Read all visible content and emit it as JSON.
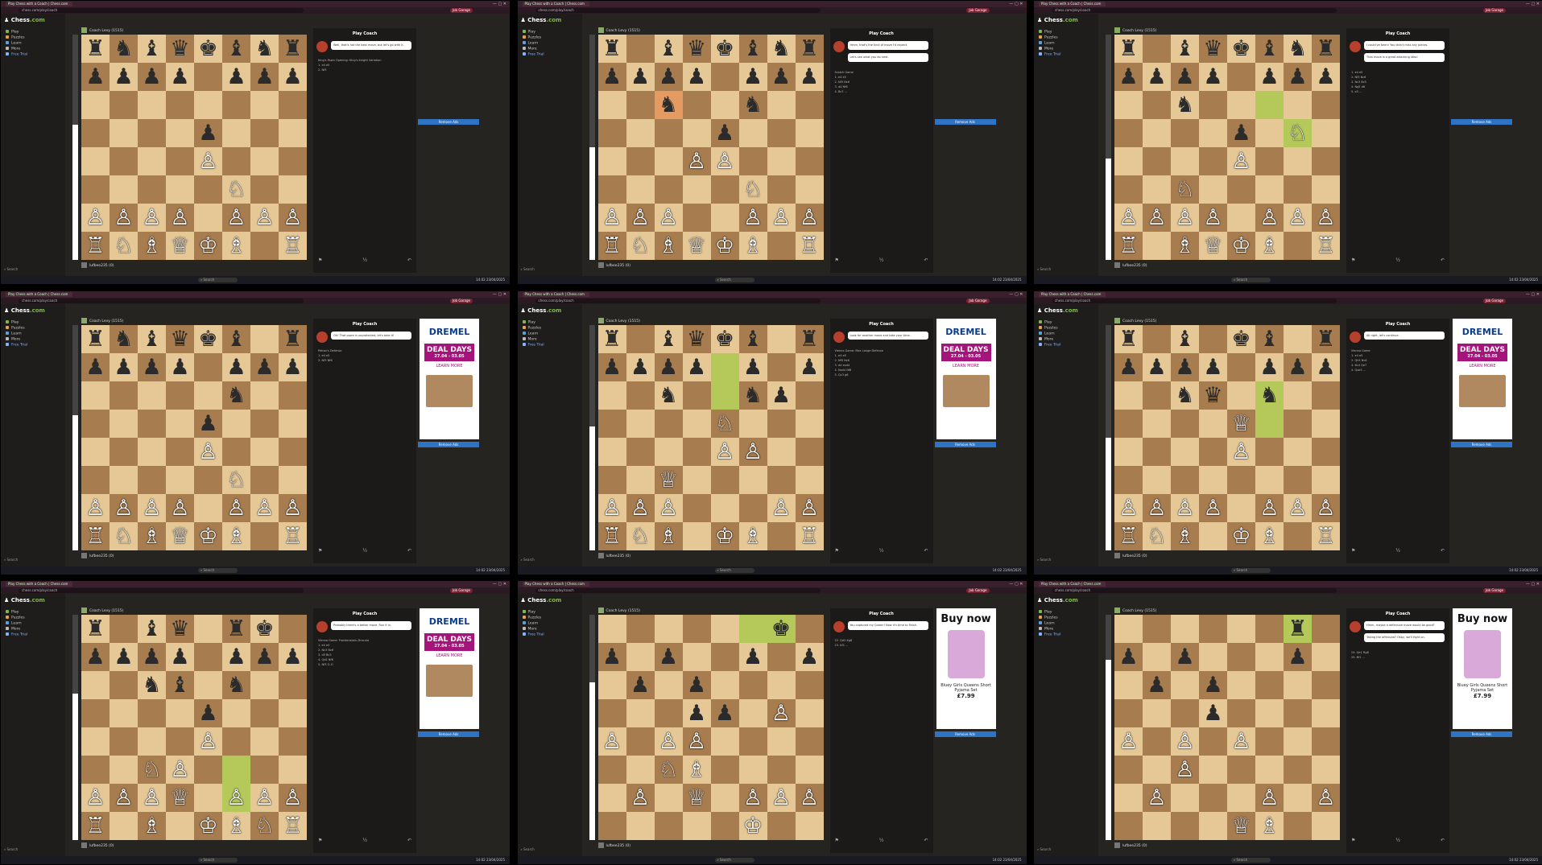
{
  "common": {
    "tab_title": "Play Chess with a Coach | Chess.com",
    "url": "chess.com/play/coach",
    "pill": "Job Garage",
    "logo_main": "Chess",
    "logo_suffix": ".com",
    "nav": [
      "Play",
      "Puzzles",
      "Learn",
      "More",
      "Free Trial"
    ],
    "nav_colors": [
      "#81b64c",
      "#e8a04b",
      "#5aa1e0",
      "#bbbbbb",
      "#7fb4ff"
    ],
    "search_label": "Search",
    "top_player": "Coach Levy (1515)",
    "bottom_player": "lufbee235 (0)",
    "coach_title": "Play Coach",
    "remove_ads": "Remove Ads",
    "taskbar_search": "Search",
    "time": "14:02",
    "date": "23/04/2025",
    "ctrl_icons": [
      "⚑",
      "½",
      "↶"
    ]
  },
  "panels": [
    {
      "eval": 0.6,
      "fen": "rnbqkbnr/pppp1ppp/8/4p3/4P3/5N2/PPPP1PPP/RNBQKB1R",
      "highlights": [],
      "bubbles": [
        "Well, that's not the best move, but let's go with it."
      ],
      "opening": "King's Pawn Opening: King's Knight Variation",
      "moves": [
        "1. e4 e5",
        "2. Nf3"
      ],
      "ad": "none"
    },
    {
      "eval": 0.5,
      "fen": "r1bqkbnr/pppp1ppp/2n2n2/4p3/3PP3/5N2/PPP2PPP/RNBQKB1R",
      "highlights": [
        [
          "c6",
          "or"
        ]
      ],
      "bubbles": [
        "Hmm, that's the kind of move I'd expect.",
        "Let's see what you do next."
      ],
      "opening": "Scotch Game",
      "moves": [
        "1. e4 e5",
        "2. Nf3 Nc6",
        "3. d4 Nf6",
        "4. Bc3 ..."
      ],
      "ad": "none"
    },
    {
      "eval": 0.45,
      "fen": "r1bqkbnr/pppp1ppp/2n5/4p1N1/4P3/2N5/PPPP1PPP/R1BQKB1R",
      "highlights": [
        [
          "f6",
          "hl"
        ],
        [
          "g5",
          "hl"
        ]
      ],
      "bubbles": [
        "I could've been! You didn't miss any pieces.",
        "That move is a great attacking idea!"
      ],
      "opening": "",
      "moves": [
        "1. e4 e5",
        "2. Nf3 Nc6",
        "3. Nc3 Bc5",
        "4. Ng5 d6",
        "5. a3 ..."
      ],
      "ad": "none"
    },
    {
      "eval": 0.6,
      "fen": "rnbqkb1r/pppp1ppp/5n2/4p3/4P3/5N2/PPPP1PPP/RNBQKB1R",
      "highlights": [],
      "bubbles": [
        "Oh! That pawn is unprotected, let's take it!"
      ],
      "opening": "Petrov's Defense",
      "moves": [
        "1. e4 e5",
        "2. Nf3 Nf6"
      ],
      "ad": "dremel"
    },
    {
      "eval": 0.55,
      "fen": "r1bqkb1r/pppp1p1p/2n2np1/4N3/4PP2/2Q5/PPP3PP/RNB1KB1R",
      "highlights": [
        [
          "e7",
          "hl"
        ],
        [
          "e6",
          "hl"
        ]
      ],
      "bubbles": [
        "Look for another move and take your time."
      ],
      "opening": "Vienna Game: Max Lange Defense",
      "moves": [
        "1. e4 e5",
        "2. Nf3 Nc6",
        "3. d4 exd4",
        "4. Nxd4 Nf6",
        "5. Qc3 g6"
      ],
      "ad": "dremel"
    },
    {
      "eval": 0.5,
      "fen": "r1b1kb1r/pppp1ppp/2nq1n2/4Q3/4P3/8/PPPP1PPP/RNB1KB1R",
      "highlights": [
        [
          "f6",
          "hl"
        ],
        [
          "f5",
          "hl"
        ]
      ],
      "bubbles": [
        "All right, let's continue."
      ],
      "opening": "Vienna Game",
      "moves": [
        "1. e4 e5",
        "2. Qh5 Nc6",
        "3. Bc4 Qe7",
        "4. Qxe5 ..."
      ],
      "ad": "dremel"
    },
    {
      "eval": 0.65,
      "fen": "r1bq1rk1/pppp1ppp/2nb1n2/4p3/4P3/2NP4/PPPQ1PPP/R1B1KBNR",
      "highlights": [
        [
          "f3",
          "hl"
        ],
        [
          "f2",
          "hl"
        ]
      ],
      "bubbles": [
        "Probably there's a better move. Run it in."
      ],
      "opening": "Vienna Game: Frankenstein-Dracula",
      "moves": [
        "1. e4 e5",
        "2. Nc3 Nc6",
        "3. d3 Bc5",
        "4. Qd2 Nf6",
        "5. Nf3 O-O"
      ],
      "ad": "dremel"
    },
    {
      "eval": 0.7,
      "fen": "6k1/p1p2p1p/1p1p4/3pp1P1/P1PP4/2NB4/1P1Q1PPP/5K2",
      "highlights": [
        [
          "f8",
          "hl"
        ],
        [
          "g8",
          "hl"
        ]
      ],
      "bubbles": [
        "You captured my Queen! Now it's time to finish."
      ],
      "opening": "",
      "moves": [
        "22. Qd2 Kg8",
        "23. Kf1 ..."
      ],
      "ad": "buynow"
    },
    {
      "eval": 0.8,
      "fen": "6r1/p1p3p1/1p1p4/3p4/P1P1P3/2P5/1P3P1P/4QB2",
      "highlights": [
        [
          "g8",
          "hl"
        ]
      ],
      "bubbles": [
        "Hmm, maybe a defensive move would be good?",
        "Taking the offensive? Okay, we'll fight on."
      ],
      "opening": "",
      "moves": [
        "24. Qe1 Rg8",
        "25. Bf1 ..."
      ],
      "ad": "buynow"
    }
  ],
  "ads": {
    "dremel": {
      "brand": "DREMEL",
      "deal": "DEAL DAYS",
      "dates": "27.04 - 03.05",
      "cta": "LEARN MORE"
    },
    "buynow": {
      "title": "Buy now",
      "product": "Bluey Girls Queens Short Pyjama Set",
      "price": "£7.99"
    }
  }
}
